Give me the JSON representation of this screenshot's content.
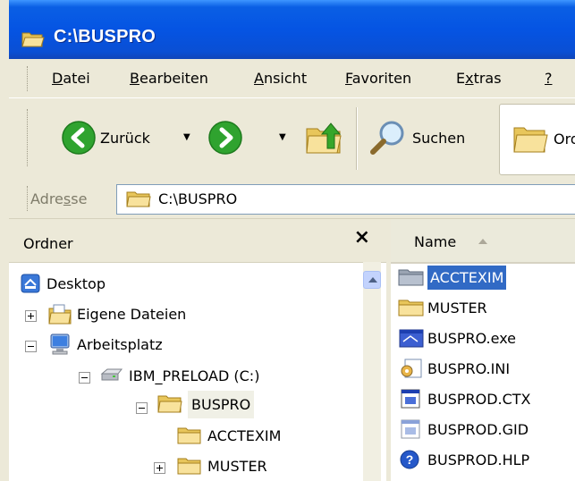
{
  "window": {
    "title": "C:\\BUSPRO"
  },
  "menubar": {
    "items": [
      {
        "pre": "",
        "ul": "D",
        "post": "atei"
      },
      {
        "pre": "",
        "ul": "B",
        "post": "earbeiten"
      },
      {
        "pre": "",
        "ul": "A",
        "post": "nsicht"
      },
      {
        "pre": "",
        "ul": "F",
        "post": "avoriten"
      },
      {
        "pre": "E",
        "ul": "x",
        "post": "tras"
      },
      {
        "pre": "",
        "ul": "?",
        "post": ""
      }
    ]
  },
  "toolbar": {
    "back_label": "Zurück",
    "search_label": "Suchen",
    "folders_label": "Ordner"
  },
  "address": {
    "label_pre": "Adre",
    "label_ul": "s",
    "label_post": "se",
    "value": "C:\\BUSPRO"
  },
  "folders_pane": {
    "title": "Ordner",
    "close": "×",
    "tree": [
      {
        "label": "Desktop"
      },
      {
        "label": "Eigene Dateien"
      },
      {
        "label": "Arbeitsplatz"
      },
      {
        "label": "IBM_PRELOAD (C:)"
      },
      {
        "label": "BUSPRO"
      },
      {
        "label": "ACCTEXIM"
      },
      {
        "label": "MUSTER"
      }
    ]
  },
  "file_list": {
    "column_name": "Name",
    "files": [
      {
        "name": "ACCTEXIM",
        "icon": "folder-gray-icon"
      },
      {
        "name": "MUSTER",
        "icon": "folder-icon"
      },
      {
        "name": "BUSPRO.exe",
        "icon": "exe-icon"
      },
      {
        "name": "BUSPRO.INI",
        "icon": "ini-settings-icon"
      },
      {
        "name": "BUSPROD.CTX",
        "icon": "ctx-file-icon"
      },
      {
        "name": "BUSPROD.GID",
        "icon": "gid-file-icon"
      },
      {
        "name": "BUSPROD.HLP",
        "icon": "help-icon"
      }
    ]
  },
  "colors": {
    "titlebar": "#0554e3",
    "selection": "#316ac5",
    "folder": "#f5d87a",
    "window_bg": "#ece9d8"
  }
}
